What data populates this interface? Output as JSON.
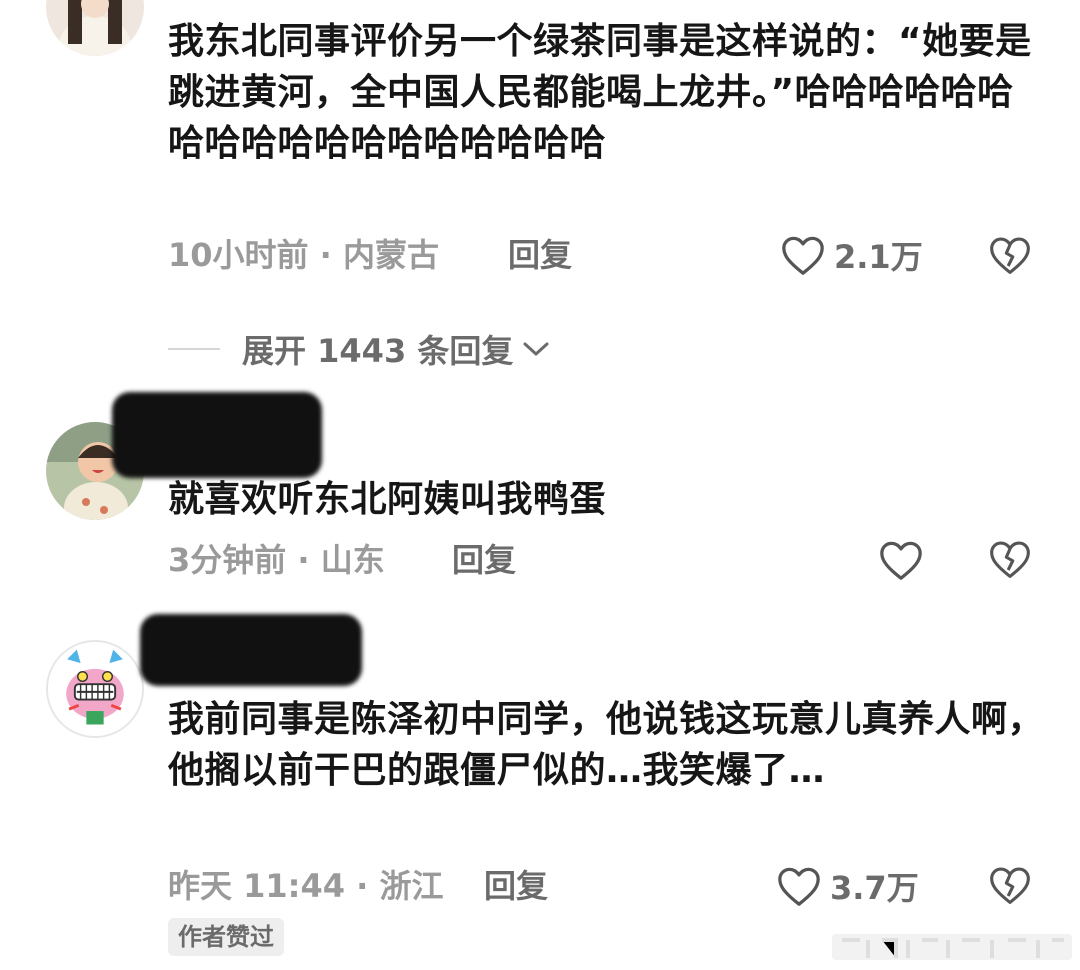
{
  "comments": [
    {
      "text": "我东北同事评价另一个绿茶同事是这样说的：“她要是跳进黄河，全中国人民都能喝上龙井。”哈哈哈哈哈哈哈哈哈哈哈哈哈哈哈哈哈哈",
      "meta": "10小时前 · 内蒙古",
      "reply_label": "回复",
      "like_count": "2.1万"
    },
    {
      "text": "就喜欢听东北阿姨叫我鸭蛋",
      "meta": "3分钟前 · 山东",
      "reply_label": "回复",
      "like_count": ""
    },
    {
      "text": "我前同事是陈泽初中同学，他说钱这玩意儿真养人啊，他搁以前干巴的跟僵尸似的…我笑爆了…",
      "meta": "昨天 11:44 · 浙江",
      "reply_label": "回复",
      "like_count": "3.7万",
      "badge": "作者赞过"
    }
  ],
  "expand_replies": "展开 1443 条回复",
  "icons": {
    "like": "heart-outline-icon",
    "dislike": "broken-heart-icon",
    "expand": "chevron-down-icon"
  },
  "colors": {
    "text": "#161616",
    "meta": "#9a9a9a",
    "action": "#6b6b6b"
  }
}
